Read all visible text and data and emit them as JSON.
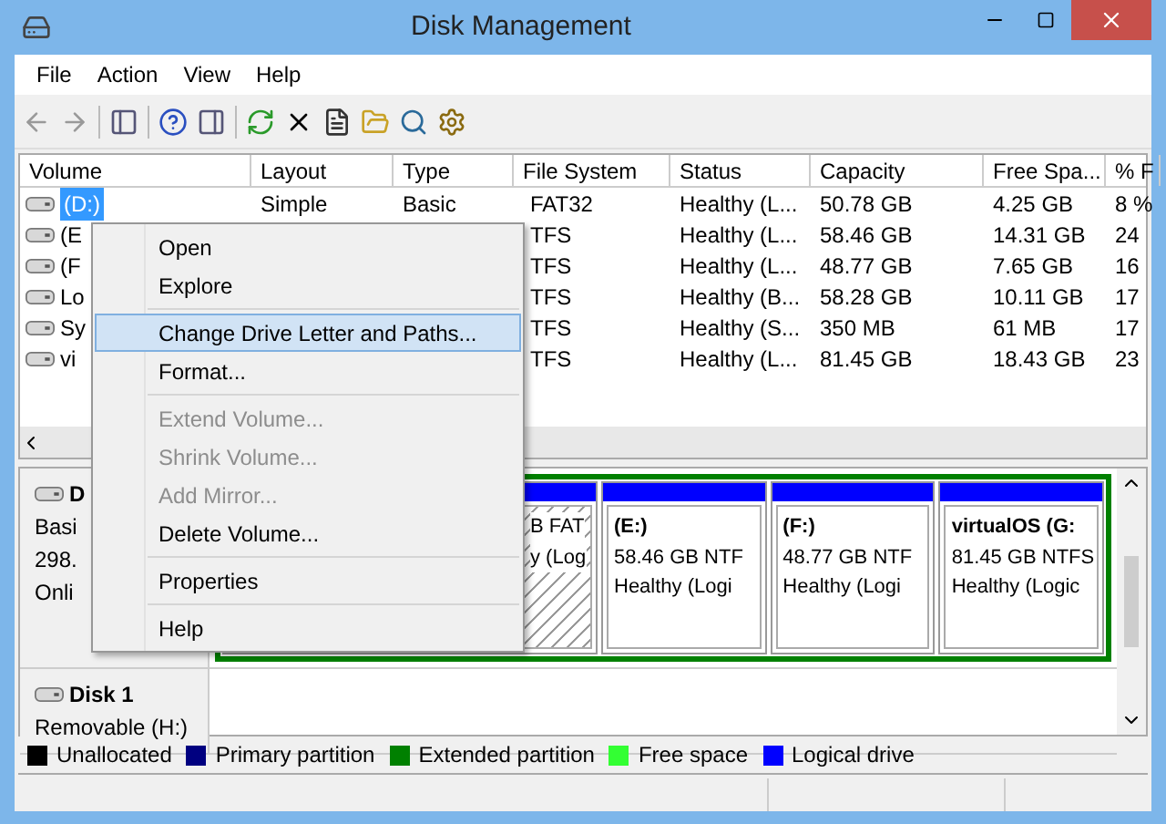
{
  "window": {
    "title": "Disk Management"
  },
  "menu_bar": [
    "File",
    "Action",
    "View",
    "Help"
  ],
  "volume_table": {
    "columns": [
      "Volume",
      "Layout",
      "Type",
      "File System",
      "Status",
      "Capacity",
      "Free Spa...",
      "% F"
    ],
    "rows": [
      {
        "selected": true,
        "cells": [
          "(D:)",
          "Simple",
          "Basic",
          "FAT32",
          "Healthy (L...",
          "50.78 GB",
          "4.25 GB",
          "8 %"
        ]
      },
      {
        "selected": false,
        "cells": [
          "(E",
          null,
          null,
          "TFS",
          "Healthy (L...",
          "58.46 GB",
          "14.31 GB",
          "24"
        ]
      },
      {
        "selected": false,
        "cells": [
          "(F",
          null,
          null,
          "TFS",
          "Healthy (L...",
          "48.77 GB",
          "7.65 GB",
          "16"
        ]
      },
      {
        "selected": false,
        "cells": [
          "Lo",
          null,
          null,
          "TFS",
          "Healthy (B...",
          "58.28 GB",
          "10.11 GB",
          "17"
        ]
      },
      {
        "selected": false,
        "cells": [
          "Sy",
          null,
          null,
          "TFS",
          "Healthy (S...",
          "350 MB",
          "61 MB",
          "17"
        ]
      },
      {
        "selected": false,
        "cells": [
          "vi",
          null,
          null,
          "TFS",
          "Healthy (L...",
          "81.45 GB",
          "18.43 GB",
          "23"
        ]
      }
    ]
  },
  "disks": [
    {
      "name": "D",
      "details": [
        "Basi",
        "298.",
        "Onli"
      ],
      "partitions": [
        {
          "selected": true,
          "lines": [
            "B FAT",
            "y (Log"
          ]
        },
        {
          "selected": false,
          "title": "(E:)",
          "lines": [
            "58.46 GB NTF",
            "Healthy (Logi"
          ]
        },
        {
          "selected": false,
          "title": "(F:)",
          "lines": [
            "48.77 GB NTF",
            "Healthy (Logi"
          ]
        },
        {
          "selected": false,
          "title": "virtualOS  (G:",
          "lines": [
            "81.45 GB NTFS",
            "Healthy (Logic"
          ]
        }
      ]
    },
    {
      "name": "Disk 1",
      "details": [
        "Removable (H:)"
      ]
    }
  ],
  "legend": [
    {
      "label": "Unallocated",
      "color": "#000000"
    },
    {
      "label": "Primary partition",
      "color": "#000080"
    },
    {
      "label": "Extended partition",
      "color": "#008000"
    },
    {
      "label": "Free space",
      "color": "#33ff33"
    },
    {
      "label": "Logical drive",
      "color": "#0000ff"
    }
  ],
  "context_menu": [
    {
      "kind": "item",
      "label": "Open",
      "disabled": false,
      "selected": false
    },
    {
      "kind": "item",
      "label": "Explore",
      "disabled": false,
      "selected": false
    },
    {
      "kind": "separator"
    },
    {
      "kind": "item",
      "label": "Change Drive Letter and Paths...",
      "disabled": false,
      "selected": true
    },
    {
      "kind": "item",
      "label": "Format...",
      "disabled": false,
      "selected": false
    },
    {
      "kind": "separator"
    },
    {
      "kind": "item",
      "label": "Extend Volume...",
      "disabled": true,
      "selected": false
    },
    {
      "kind": "item",
      "label": "Shrink Volume...",
      "disabled": true,
      "selected": false
    },
    {
      "kind": "item",
      "label": "Add Mirror...",
      "disabled": true,
      "selected": false
    },
    {
      "kind": "item",
      "label": "Delete Volume...",
      "disabled": false,
      "selected": false
    },
    {
      "kind": "separator"
    },
    {
      "kind": "item",
      "label": "Properties",
      "disabled": false,
      "selected": false
    },
    {
      "kind": "separator"
    },
    {
      "kind": "item",
      "label": "Help",
      "disabled": false,
      "selected": false
    }
  ]
}
